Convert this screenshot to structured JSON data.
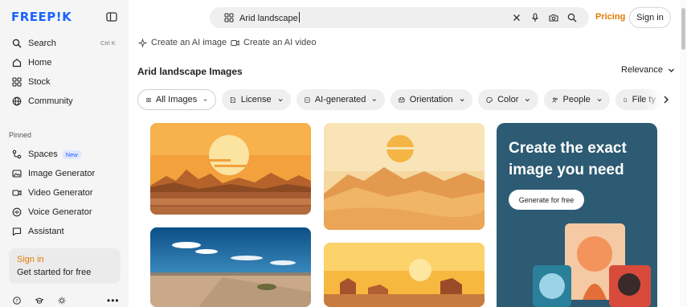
{
  "brand": {
    "logo_text": "FREEP!K",
    "accent": "#1a63ff",
    "orange": "#e07a00"
  },
  "sidebar": {
    "items": [
      {
        "label": "Search",
        "icon": "search-icon",
        "shortcut": "Ctrl K"
      },
      {
        "label": "Home",
        "icon": "home-icon"
      },
      {
        "label": "Stock",
        "icon": "stock-icon"
      },
      {
        "label": "Community",
        "icon": "globe-icon"
      }
    ],
    "pinned_label": "Pinned",
    "pinned": [
      {
        "label": "Spaces",
        "icon": "spaces-icon",
        "badge": "New"
      },
      {
        "label": "Image Generator",
        "icon": "image-icon"
      },
      {
        "label": "Video Generator",
        "icon": "video-icon"
      },
      {
        "label": "Voice Generator",
        "icon": "voice-icon"
      },
      {
        "label": "Assistant",
        "icon": "assistant-icon"
      }
    ],
    "signin_card": {
      "title": "Sign in",
      "subtitle": "Get started for free"
    }
  },
  "search": {
    "query": "Arid landscape"
  },
  "header": {
    "pricing": "Pricing",
    "signin": "Sign in"
  },
  "sublinks": {
    "image": "Create an AI image",
    "video": "Create an AI video"
  },
  "results": {
    "title": "Arid landscape Images",
    "sort": "Relevance"
  },
  "filters": [
    {
      "label": "All Images",
      "icon": "grid-icon",
      "active": true
    },
    {
      "label": "License",
      "icon": "license-icon"
    },
    {
      "label": "AI-generated",
      "icon": "ai-icon"
    },
    {
      "label": "Orientation",
      "icon": "orientation-icon"
    },
    {
      "label": "Color",
      "icon": "palette-icon"
    },
    {
      "label": "People",
      "icon": "people-icon"
    },
    {
      "label": "File ty",
      "icon": "file-icon"
    }
  ],
  "promo": {
    "headline": "Create the exact image you need",
    "cta": "Generate for free"
  }
}
